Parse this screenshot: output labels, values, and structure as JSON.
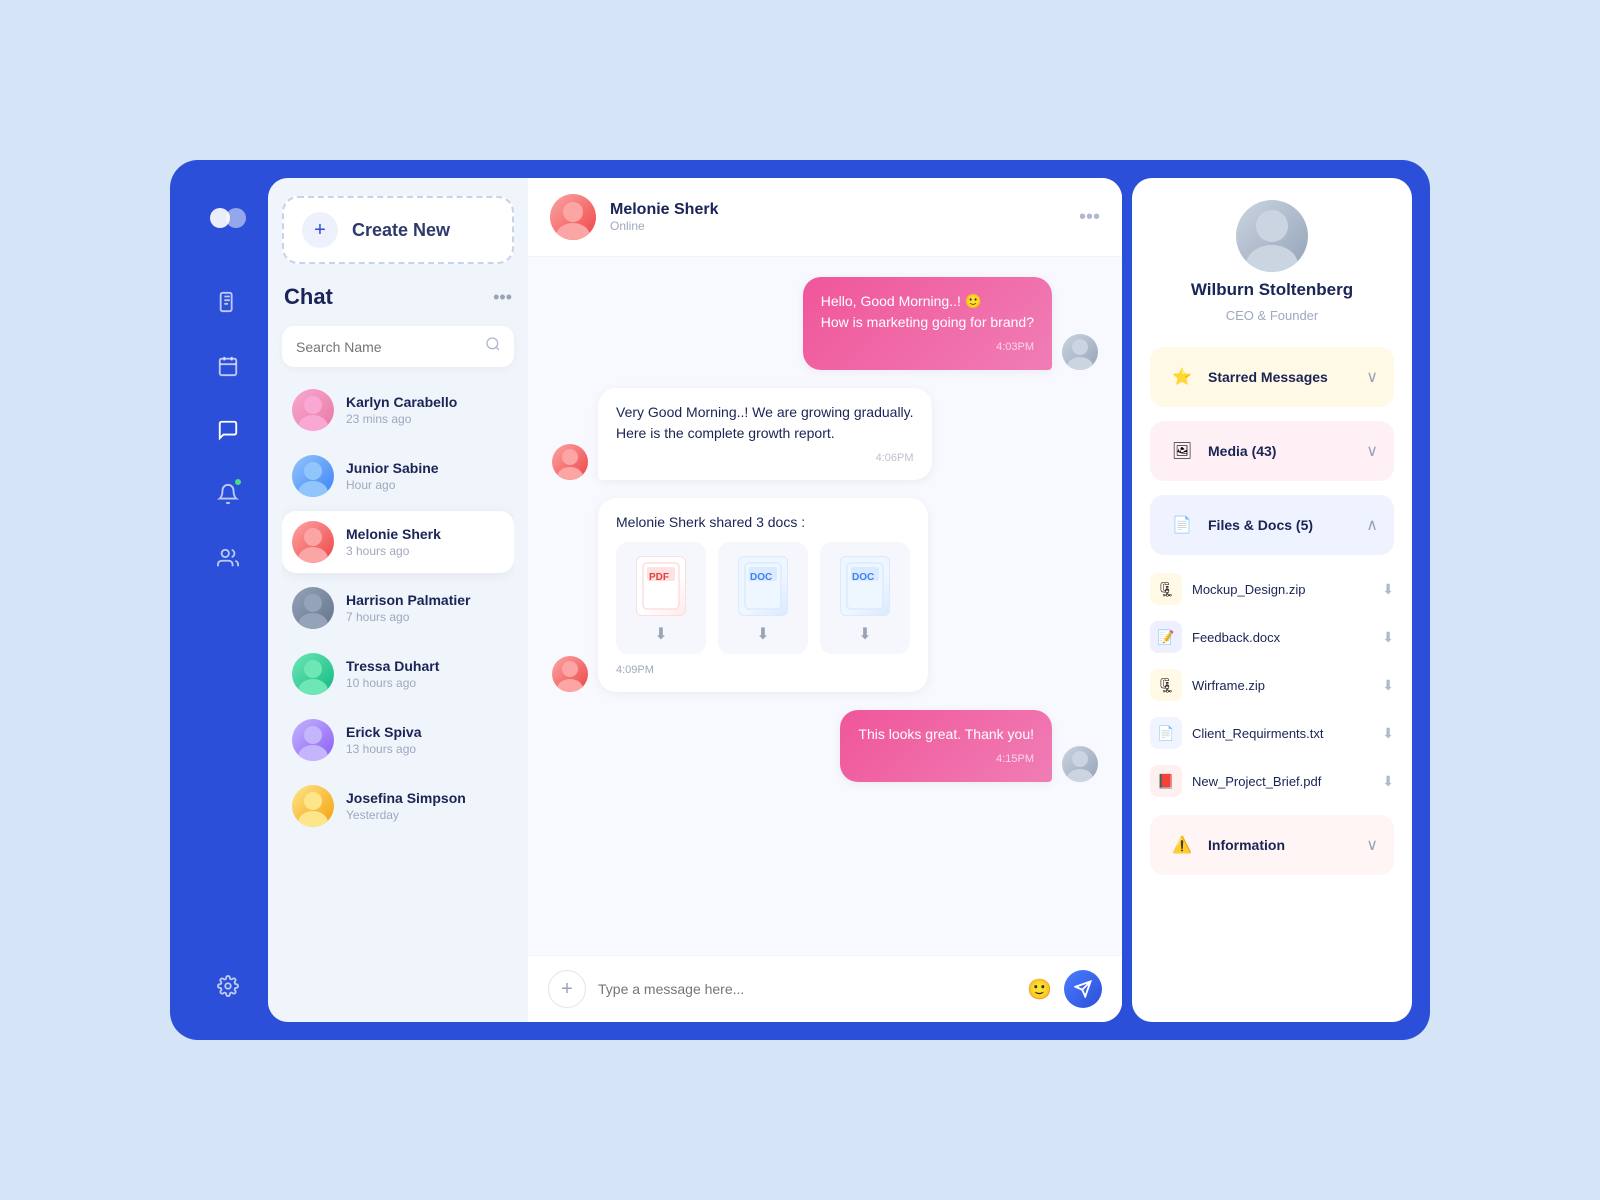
{
  "sidebar": {
    "logo_alt": "logo",
    "icons": [
      {
        "name": "document-icon",
        "symbol": "📄"
      },
      {
        "name": "calendar-icon",
        "symbol": "📅"
      },
      {
        "name": "chat-icon",
        "symbol": "💬"
      },
      {
        "name": "notification-icon",
        "symbol": "🔔",
        "has_dot": true
      },
      {
        "name": "group-icon",
        "symbol": "👥"
      },
      {
        "name": "settings-icon",
        "symbol": "⚙️"
      }
    ]
  },
  "chat_list": {
    "create_new_label": "Create New",
    "title": "Chat",
    "search_placeholder": "Search Name",
    "contacts": [
      {
        "name": "Karlyn Carabello",
        "time": "23 mins ago",
        "avatar_class": "av-karlyn"
      },
      {
        "name": "Junior Sabine",
        "time": "Hour ago",
        "avatar_class": "av-junior"
      },
      {
        "name": "Melonie Sherk",
        "time": "3 hours ago",
        "avatar_class": "av-melonie",
        "active": true
      },
      {
        "name": "Harrison Palmatier",
        "time": "7 hours ago",
        "avatar_class": "av-harrison"
      },
      {
        "name": "Tressa Duhart",
        "time": "10 hours ago",
        "avatar_class": "av-tressa"
      },
      {
        "name": "Erick Spiva",
        "time": "13 hours ago",
        "avatar_class": "av-erick"
      },
      {
        "name": "Josefina Simpson",
        "time": "Yesterday",
        "avatar_class": "av-josefina"
      }
    ]
  },
  "chat_main": {
    "contact_name": "Melonie Sherk",
    "contact_status": "Online",
    "messages": [
      {
        "type": "sent",
        "text": "Hello, Good Morning..! 🙂\nHow is marketing going for brand?",
        "time": "4:03PM",
        "avatar_class": "av-wilburn"
      },
      {
        "type": "received",
        "text": "Very Good Morning..! We are growing gradually.\nHere is the complete growth report.",
        "time": "4:06PM",
        "avatar_class": "av-melonie"
      },
      {
        "type": "shared_docs",
        "label": "Melonie Sherk shared 3 docs :",
        "time": "4:09PM",
        "docs": [
          {
            "type": "pdf",
            "label": "PDF"
          },
          {
            "type": "doc",
            "label": "DOC"
          },
          {
            "type": "doc",
            "label": "DOC"
          }
        ],
        "avatar_class": "av-melonie"
      },
      {
        "type": "sent",
        "text": "This looks great. Thank you!",
        "time": "4:15PM",
        "avatar_class": "av-wilburn"
      }
    ],
    "input_placeholder": "Type a message here..."
  },
  "right_panel": {
    "profile": {
      "name": "Wilburn Stoltenberg",
      "role": "CEO & Founder",
      "avatar_class": "av-wilburn"
    },
    "info_cards": [
      {
        "label": "Starred Messages",
        "icon": "⭐",
        "color": "yellow"
      },
      {
        "label": "Media (43)",
        "icon": "🖼",
        "color": "pink"
      },
      {
        "label": "Files & Docs (5)",
        "icon": "📄",
        "color": "blue",
        "expanded": true
      },
      {
        "label": "Information",
        "icon": "⚠️",
        "color": "light-red"
      }
    ],
    "files": [
      {
        "name": "Mockup_Design.zip",
        "icon": "🗜",
        "icon_class": "zip"
      },
      {
        "name": "Feedback.docx",
        "icon": "📝",
        "icon_class": "doc"
      },
      {
        "name": "Wirframe.zip",
        "icon": "🗜",
        "icon_class": "zip"
      },
      {
        "name": "Client_Requirments.txt",
        "icon": "📄",
        "icon_class": "txt"
      },
      {
        "name": "New_Project_Brief.pdf",
        "icon": "📕",
        "icon_class": "pdf"
      }
    ]
  }
}
